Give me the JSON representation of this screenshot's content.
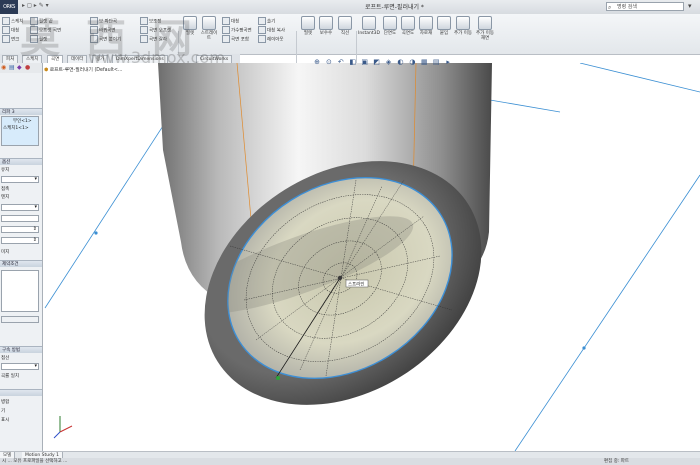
{
  "app": {
    "brand": "ORKS",
    "document_title": "로프트-루면-필러내기 *",
    "search_placeholder": "명령 검색",
    "tree_root": "로프트-루면-필러내기 (Default<...",
    "sketch_label": "0.도면다"
  },
  "ribbon": {
    "small_items": [
      "스케치",
      "대칭",
      "면크",
      "필렛 끝",
      "오프셋 곡면",
      "필렛",
      "보 파단곡",
      "바뀌곡면",
      "곡면 붙이기",
      "보조정",
      "곡면 오프셋",
      "곡면 잘라",
      "가수평곡면",
      "곡면 포함",
      "솔기",
      "대칭 복사"
    ],
    "large_items": [
      "필렛",
      "스트레이트",
      "대칭",
      "레이아웃",
      "필렛",
      "보수수",
      "직선",
      "Instant3D",
      "단면도",
      "곡면도",
      "자로재",
      "붙임",
      "추가 이동",
      "추가 이동 재면"
    ]
  },
  "command_tabs": [
    "피처",
    "스케치",
    "곡면",
    "데이터",
    "평가",
    "DimXpertDimensions",
    "CircuitWorks"
  ],
  "left_panel": {
    "top_label": "리파 3",
    "list_items": [
      "부인<1>",
      "스케치1<1>"
    ],
    "section_1": "옵션",
    "row_1": "유지",
    "row_2": "접촉",
    "row_3": "텐지",
    "section_2": "제약조건",
    "row_4": "미지",
    "section_3": "구속 방법",
    "row_5": "접선",
    "row_6": "곡률 일치",
    "row_7": "병합",
    "row_8": "기",
    "row_9": "표시"
  },
  "bottom_tabs": [
    "모델",
    "Motion Study 1"
  ],
  "status": {
    "left": "시 ... 모유 프로파일을 선택하고 ...",
    "right": "편집 중: 파트"
  },
  "viewport": {
    "callout": "스프라인"
  },
  "watermark": {
    "cn": "莫西网",
    "url": "www.3dmox.com"
  },
  "colors": {
    "accent": "#2b3a55",
    "selection": "#3d8fd6",
    "construction_line": "#3b8fd3"
  }
}
